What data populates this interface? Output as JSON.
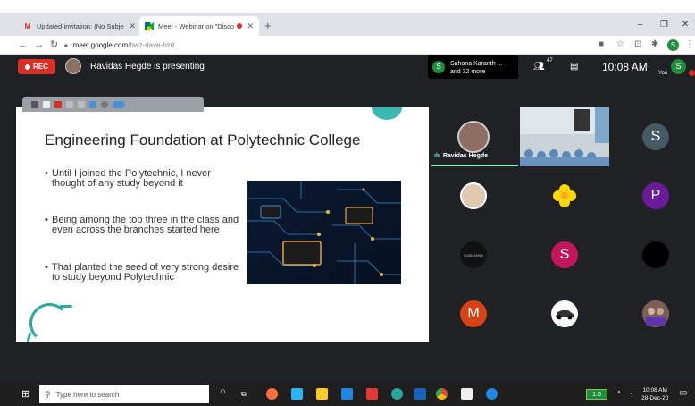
{
  "browser": {
    "tabs": [
      {
        "icon": "gmail-icon",
        "title": "Updated invitation: (No Subject)"
      },
      {
        "icon": "meet-icon",
        "title": "Meet - Webinar on \"Discove"
      }
    ],
    "url_host": "meet.google.com",
    "url_path": "/bwz-dave-bzd",
    "profile_letter": "S"
  },
  "meet": {
    "rec_label": "REC",
    "presenting_text": "Ravidas Hegde is presenting",
    "participants_line1": "Sahana Karanth ...",
    "participants_line2": "and 32 more",
    "people_count": "47",
    "clock": "10:08 AM",
    "you_letter": "S",
    "you_label": "You"
  },
  "slide": {
    "title": "Engineering Foundation at Polytechnic College",
    "bullets": [
      "Until I joined the Polytechnic, I never thought of any study beyond it",
      "Being among the top three in the class and even across the branches started here",
      "That planted the seed of very strong desire to study beyond Polytechnic"
    ]
  },
  "tiles": [
    {
      "kind": "photo",
      "name": "Ravidas Hegde",
      "active": true
    },
    {
      "kind": "video"
    },
    {
      "kind": "letter",
      "letter": "S",
      "color": "#455a64"
    },
    {
      "kind": "photo"
    },
    {
      "kind": "flower"
    },
    {
      "kind": "letter",
      "letter": "P",
      "color": "#6a1b9a"
    },
    {
      "kind": "logo",
      "text": "SUBHANNA"
    },
    {
      "kind": "letter",
      "letter": "S",
      "color": "#c2185b"
    },
    {
      "kind": "blank",
      "color": "#000000"
    },
    {
      "kind": "letter",
      "letter": "M",
      "color": "#d84315"
    },
    {
      "kind": "car"
    },
    {
      "kind": "group"
    }
  ],
  "taskbar": {
    "search_placeholder": "Type here to search",
    "time": "10:08 AM",
    "date": "28-Dec-20",
    "battery": "1.0"
  }
}
